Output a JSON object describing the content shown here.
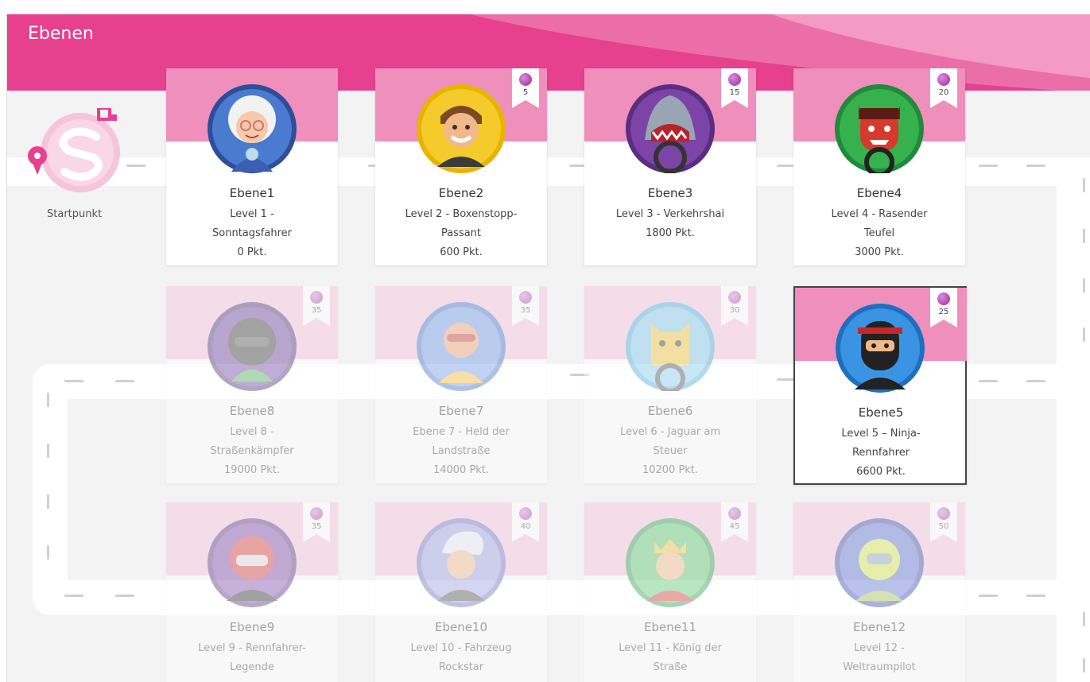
{
  "header": {
    "title": "Ebenen"
  },
  "start": {
    "label": "Startpunkt",
    "icon": "start-logo-icon"
  },
  "colors": {
    "accent": "#e6408f",
    "band": "#ef8fbb",
    "gem": "#a0269a"
  },
  "levels": [
    {
      "name": "Ebene1",
      "line1": "Level 1 -",
      "line2": "Sonntagsfahrer",
      "line3": "0 Pkt.",
      "badge": "Sunday Driver",
      "gems": "",
      "unlocked": true,
      "selected": false
    },
    {
      "name": "Ebene2",
      "line1": "Level 2 - Boxenstopp-",
      "line2": "Passant",
      "line3": "600 Pkt.",
      "badge": "Pit Stop Pedro",
      "gems": "5",
      "unlocked": true,
      "selected": false
    },
    {
      "name": "Ebene3",
      "line1": "Level 3 - Verkehrshai",
      "line2": "1800 Pkt.",
      "line3": "",
      "badge": "Traffic Shark",
      "gems": "15",
      "unlocked": true,
      "selected": false
    },
    {
      "name": "Ebene4",
      "line1": "Level 4 - Rasender",
      "line2": "Teufel",
      "line3": "3000 Pkt.",
      "badge": "Speed Demon",
      "gems": "20",
      "unlocked": true,
      "selected": false
    },
    {
      "name": "Ebene5",
      "line1": "Level 5 – Ninja-",
      "line2": "Rennfahrer",
      "line3": "6600 Pkt.",
      "badge": "Turbo Ninja",
      "gems": "25",
      "unlocked": true,
      "selected": true
    },
    {
      "name": "Ebene6",
      "line1": "Level 6 - Jaguar am",
      "line2": "Steuer",
      "line3": "10200 Pkt.",
      "badge": "Cheetah Wheel",
      "gems": "30",
      "unlocked": false,
      "selected": false
    },
    {
      "name": "Ebene7",
      "line1": "Ebene 7 - Held der",
      "line2": "Landstraße",
      "line3": "14000 Pkt.",
      "badge": "Highway Hero",
      "gems": "35",
      "unlocked": false,
      "selected": false
    },
    {
      "name": "Ebene8",
      "line1": "Level 8 -",
      "line2": "Straßenkämpfer",
      "line3": "19000 Pkt.",
      "badge": "Road Warrior",
      "gems": "35",
      "unlocked": false,
      "selected": false
    },
    {
      "name": "Ebene9",
      "line1": "Level 9 - Rennfahrer-",
      "line2": "Legende",
      "line3": "",
      "badge": "Racing Legend",
      "gems": "35",
      "unlocked": false,
      "selected": false
    },
    {
      "name": "Ebene10",
      "line1": "Level 10 - Fahrzeug",
      "line2": "Rockstar",
      "line3": "",
      "badge": "Car Rockstar",
      "gems": "40",
      "unlocked": false,
      "selected": false
    },
    {
      "name": "Ebene11",
      "line1": "Level 11 - König der",
      "line2": "Straße",
      "line3": "",
      "badge": "King of the Road",
      "gems": "45",
      "unlocked": false,
      "selected": false
    },
    {
      "name": "Ebene12",
      "line1": "Level 12 -",
      "line2": "Weltraumpilot",
      "line3": "",
      "badge": "Space Rider",
      "gems": "50",
      "unlocked": false,
      "selected": false
    }
  ]
}
